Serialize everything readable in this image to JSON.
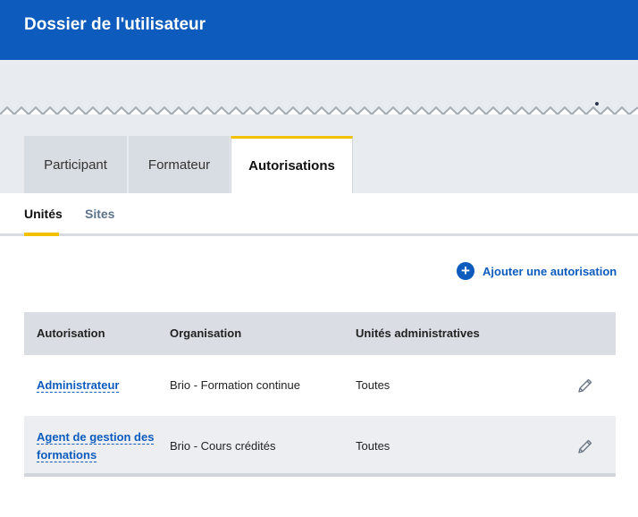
{
  "header": {
    "title": "Dossier de l'utilisateur"
  },
  "tabs": [
    "Participant",
    "Formateur",
    "Autorisations"
  ],
  "subtabs": [
    "Unités",
    "Sites"
  ],
  "actions": {
    "add_label": "Ajouter une autorisation"
  },
  "table": {
    "headers": [
      "Autorisation",
      "Organisation",
      "Unités administratives"
    ],
    "rows": [
      {
        "autorisation": "Administrateur",
        "organisation": "Brio - Formation continue",
        "unites": "Toutes"
      },
      {
        "autorisation_line1": "Agent de gestion des",
        "autorisation_line2": "formations",
        "organisation": "Brio - Cours crédités",
        "unites": "Toutes"
      }
    ]
  },
  "colors": {
    "header": "#0d5cbd",
    "accent": "#f2c200",
    "link": "#0d5cbd"
  }
}
